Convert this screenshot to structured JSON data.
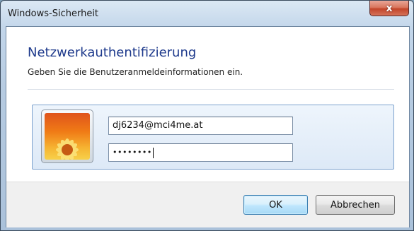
{
  "window": {
    "title": "Windows-Sicherheit",
    "close_glyph": "x"
  },
  "dialog": {
    "heading": "Netzwerkauthentifizierung",
    "subheading": "Geben Sie die Benutzeranmeldeinformationen ein.",
    "username_value": "dj6234@mci4me.at",
    "password_mask": "••••••••",
    "avatar_icon": "user-flower-avatar-icon"
  },
  "buttons": {
    "ok_label": "OK",
    "cancel_label": "Abbrechen"
  },
  "colors": {
    "heading": "#1e3a8c",
    "close_button": "#c2452a",
    "ok_border": "#3c7fb1"
  }
}
